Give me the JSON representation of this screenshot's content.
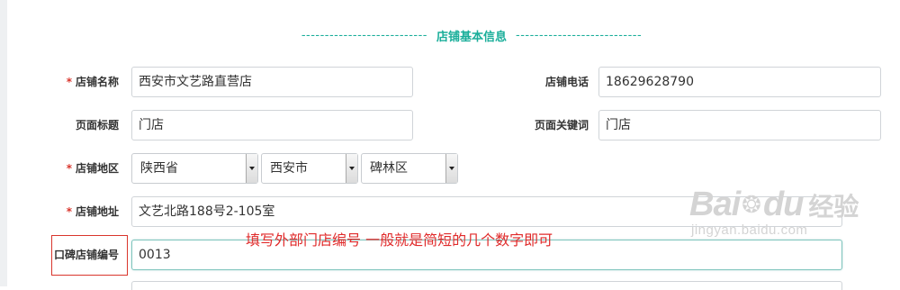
{
  "section": {
    "title": "店铺基本信息",
    "dashes_left": "---------------------------",
    "dashes_right": "---------------------------"
  },
  "required_mark": "*",
  "fields": {
    "store_name": {
      "label": "店铺名称",
      "value": "西安市文艺路直营店"
    },
    "store_phone": {
      "label": "店铺电话",
      "value": "18629628790"
    },
    "page_title": {
      "label": "页面标题",
      "value": "门店"
    },
    "page_keywords": {
      "label": "页面关键词",
      "value": "门店"
    },
    "store_region": {
      "label": "店铺地区",
      "province": "陕西省",
      "city": "西安市",
      "district": "碑林区"
    },
    "store_address": {
      "label": "店铺地址",
      "value": "文艺北路188号2-105室"
    },
    "koubei_store_no": {
      "label": "口碑店铺编号",
      "value": "0013"
    }
  },
  "annotation": "填写外部门店编号 一般就是简短的几个数字即可",
  "watermark": {
    "brand_a": "Bai",
    "brand_b": "经验",
    "url": "jingyan.baidu.com"
  },
  "colors": {
    "accent": "#1aae9a",
    "required": "#d9352c",
    "annotation": "#e02b2b"
  }
}
